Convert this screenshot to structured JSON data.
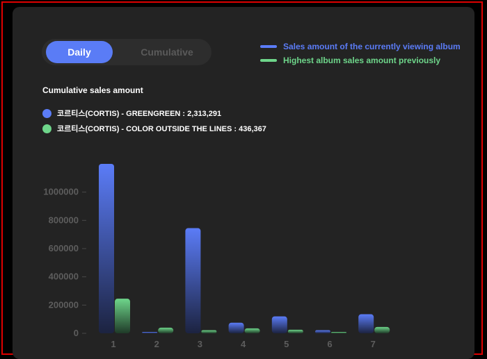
{
  "toggle": {
    "daily_label": "Daily",
    "cumulative_label": "Cumulative",
    "selected": "Daily"
  },
  "legend": {
    "current_label": "Sales amount of the currently viewing album",
    "previous_label": "Highest album sales amount previously"
  },
  "section_title": "Cumulative sales amount",
  "colors": {
    "current": "#5b7cf7",
    "previous": "#6ed58a",
    "current_dark": "#1c2340",
    "previous_dark": "#1f3a28"
  },
  "series_list": [
    {
      "name": "코르티스(CORTIS) - GREENGREEN : 2,313,291"
    },
    {
      "name": "코르티스(CORTIS) - COLOR OUTSIDE THE LINES : 436,367"
    }
  ],
  "chart_data": {
    "type": "bar",
    "categories": [
      "1",
      "2",
      "3",
      "4",
      "5",
      "6",
      "7"
    ],
    "series": [
      {
        "name": "Sales amount of the currently viewing album",
        "values": [
          1200000,
          5000,
          745000,
          75000,
          120000,
          22000,
          135000
        ]
      },
      {
        "name": "Highest album sales amount previously",
        "values": [
          245000,
          40000,
          22000,
          35000,
          25000,
          5000,
          45000
        ]
      }
    ],
    "yticks": [
      "0",
      "200000",
      "400000",
      "600000",
      "800000",
      "1000000"
    ],
    "ylim": [
      0,
      1200000
    ],
    "grid": false,
    "xlabel": "",
    "ylabel": "",
    "title": ""
  }
}
